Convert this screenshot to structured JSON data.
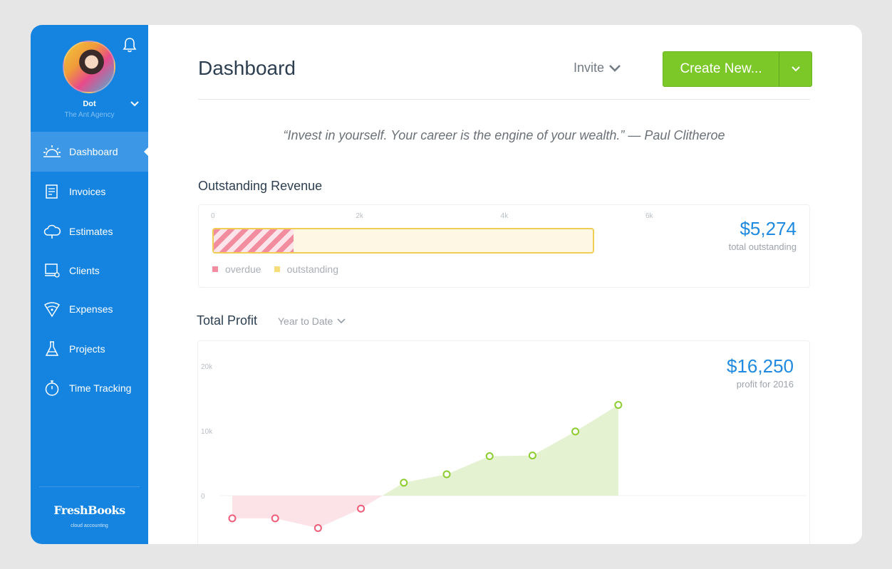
{
  "user": {
    "name": "Dot",
    "org": "The Ant Agency"
  },
  "nav": [
    {
      "label": "Dashboard",
      "icon": "dashboard-icon",
      "active": true
    },
    {
      "label": "Invoices",
      "icon": "invoice-icon"
    },
    {
      "label": "Estimates",
      "icon": "cloud-icon"
    },
    {
      "label": "Clients",
      "icon": "clients-icon"
    },
    {
      "label": "Expenses",
      "icon": "expenses-icon"
    },
    {
      "label": "Projects",
      "icon": "flask-icon"
    },
    {
      "label": "Time Tracking",
      "icon": "stopwatch-icon"
    }
  ],
  "brand": {
    "logo": "FreshBooks",
    "tagline": "cloud accounting"
  },
  "header": {
    "title": "Dashboard",
    "invite_label": "Invite",
    "create_label": "Create New..."
  },
  "quote": "“Invest in yourself. Your career is the engine of your wealth.” — Paul Clitheroe",
  "outstanding": {
    "title": "Outstanding Revenue",
    "ticks": [
      "0",
      "2k",
      "4k",
      "6k"
    ],
    "total_amount": "$5,274",
    "total_label": "total outstanding",
    "legend": [
      {
        "label": "overdue",
        "color": "#f28da0"
      },
      {
        "label": "outstanding",
        "color": "#f7dd7a"
      }
    ]
  },
  "profit": {
    "title": "Total Profit",
    "period": "Year to Date",
    "amount": "$16,250",
    "amount_label": "profit for 2016"
  },
  "colors": {
    "sidebar": "#1584e0",
    "accent": "#1f8ae0",
    "create_button": "#7cc828",
    "positive": "#8dcc2e",
    "negative": "#ee5d78"
  },
  "chart_data": [
    {
      "type": "bar",
      "orientation": "horizontal",
      "stacked": true,
      "categories": [
        "Outstanding Revenue"
      ],
      "series": [
        {
          "name": "overdue",
          "values": [
            1100
          ]
        },
        {
          "name": "outstanding",
          "values": [
            4174
          ]
        }
      ],
      "xlim": [
        0,
        6000
      ],
      "x_ticks": [
        "0",
        "2k",
        "4k",
        "6k"
      ],
      "legend": "bottom-left"
    },
    {
      "type": "area",
      "ylim": [
        -5000,
        20000
      ],
      "y_ticks": [
        "0",
        "10k",
        "20k"
      ],
      "y_tick_values": [
        0,
        10000,
        20000
      ],
      "x": [
        1,
        2,
        3,
        4,
        5,
        6,
        7,
        8,
        9,
        10
      ],
      "values": [
        -3500,
        -3500,
        -5000,
        -2000,
        2000,
        3300,
        6100,
        6200,
        9900,
        14000
      ],
      "grid": false,
      "legend": "none"
    }
  ]
}
